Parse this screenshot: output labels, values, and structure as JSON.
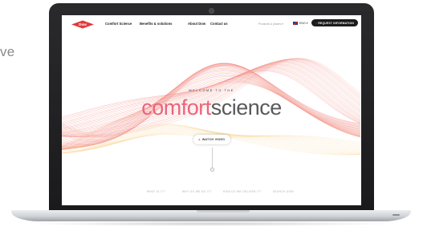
{
  "side_text": "ve",
  "nav": {
    "logo_text": "DOW",
    "links": [
      "Comfort Science",
      "Benefits & solutions",
      "About Dow",
      "Contact us"
    ],
    "benefits_chevron": "⌄",
    "region": "Products & places ▾",
    "language": "ENG ▾",
    "request_button": "REQUEST INFORMATION"
  },
  "hero": {
    "welcome": "WELCOME TO THE",
    "headline_part1": "comfort",
    "headline_part2": "science",
    "watch_button": "WATCH VIDEO"
  },
  "bottom_nav": [
    "WHAT IS IT?",
    "WHY DO WE DO IT?",
    "HOW DO WE DELIVER IT?",
    "SEARCH DOW"
  ],
  "colors": {
    "brand_red": "#e03a3a",
    "headline_pink": "#e9657e",
    "headline_gray": "#5a5a5a",
    "wave_colors": [
      "#f6a38a",
      "#ea5f86",
      "#f0a0c0",
      "#f8c36e",
      "#f27e7a"
    ]
  }
}
